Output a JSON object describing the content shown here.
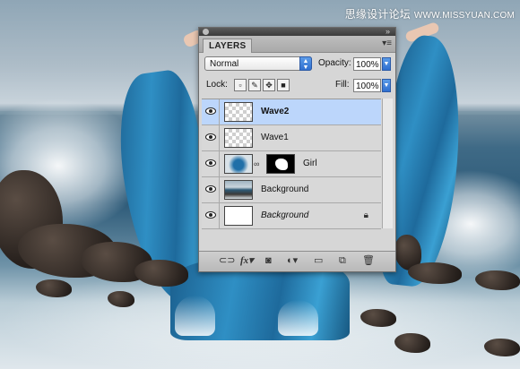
{
  "watermark": {
    "cn": "思缘设计论坛",
    "en": "WWW.MISSYUAN.COM"
  },
  "panel": {
    "tab_label": "LAYERS",
    "menu_icon": "panel-menu-icon",
    "blend_mode": "Normal",
    "opacity_label": "Opacity:",
    "opacity_value": "100%",
    "lock_label": "Lock:",
    "fill_label": "Fill:",
    "fill_value": "100%",
    "lock_icons": [
      "lock-transparent-icon",
      "lock-image-icon",
      "lock-position-icon",
      "lock-all-icon"
    ],
    "layers": [
      {
        "name": "Wave2",
        "selected": true,
        "thumb": "transparent"
      },
      {
        "name": "Wave1",
        "selected": false,
        "thumb": "transparent"
      },
      {
        "name": "Girl",
        "selected": false,
        "thumb": "photo-with-mask"
      },
      {
        "name": "Background",
        "selected": false,
        "thumb": "photo"
      },
      {
        "name": "Background",
        "selected": false,
        "thumb": "white",
        "italic": true,
        "locked": true
      }
    ],
    "bottom_icons": [
      "link-layers-icon",
      "fx-icon",
      "add-mask-icon",
      "adjustment-layer-icon",
      "new-group-icon",
      "new-layer-icon",
      "trash-icon"
    ],
    "fx_label": "fx"
  },
  "colors": {
    "selection": "#bcd6fb",
    "accent": "#2f6fd0"
  }
}
